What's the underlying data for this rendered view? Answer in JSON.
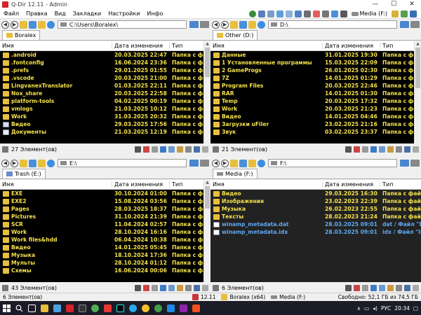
{
  "window": {
    "title": "Q-Dir 12.11 - Admin",
    "controls": [
      "—",
      "☐",
      "✕"
    ]
  },
  "menu": [
    "Файл",
    "Правка",
    "Вид",
    "Закладки",
    "Настройки",
    "Инфо"
  ],
  "toolbar": {
    "drive_label": "Media (F:)"
  },
  "columns": {
    "name": "Имя",
    "date": "Дата изменения",
    "type": "Тип"
  },
  "panes": [
    {
      "tab": "Boralex",
      "path": "C:\\Users\\Boralex\\",
      "status": "27 Элемент(ов)",
      "scroll": {
        "thumb_start": 0.0,
        "thumb_size": 0.33
      },
      "rows": [
        {
          "name": ".android",
          "date": "20.03.2025 22:47",
          "type": "Папка с фай",
          "icon": "folder"
        },
        {
          "name": ".fontconfig",
          "date": "16.06.2024 23:36",
          "type": "Папка с фай",
          "icon": "folder"
        },
        {
          "name": ".prefs",
          "date": "29.01.2025 01:55",
          "type": "Папка с фай",
          "icon": "folder"
        },
        {
          "name": ".vscode",
          "date": "20.03.2025 21:00",
          "type": "Папка с фай",
          "icon": "folder"
        },
        {
          "name": "LingvanexTranslator",
          "date": "01.03.2025 22:11",
          "type": "Папка с фай",
          "icon": "folder"
        },
        {
          "name": "Nox_share",
          "date": "20.03.2025 22:58",
          "type": "Папка с фай",
          "icon": "folder"
        },
        {
          "name": "platform-tools",
          "date": "04.02.2025 00:19",
          "type": "Папка с фай",
          "icon": "folder"
        },
        {
          "name": "vmlogs",
          "date": "21.03.2025 10:12",
          "type": "Папка с фай",
          "icon": "folder"
        },
        {
          "name": "Work",
          "date": "31.03.2025 20:32",
          "type": "Папка с фай",
          "icon": "folder"
        },
        {
          "name": "Видео",
          "date": "29.03.2025 17:56",
          "type": "Папка с фай",
          "icon": "video"
        },
        {
          "name": "Документы",
          "date": "21.03.2025 12:19",
          "type": "Папка с фай",
          "icon": "doc"
        }
      ]
    },
    {
      "tab": "Other (D:)",
      "path": "D:\\",
      "status": "21 Элемент(ов)",
      "scroll": {
        "thumb_start": 0.0,
        "thumb_size": 0.45
      },
      "rows": [
        {
          "name": "Данные",
          "date": "31.01.2025 19:30",
          "type": "Папка с фай",
          "icon": "folder"
        },
        {
          "name": "1 Установленные программы",
          "date": "15.03.2025 22:09",
          "type": "Папка с фай",
          "icon": "folder"
        },
        {
          "name": "2 GameProgs",
          "date": "26.01.2025 02:30",
          "type": "Папка с фай",
          "icon": "folder"
        },
        {
          "name": "7Z",
          "date": "14.01.2025 01:29",
          "type": "Папка с фай",
          "icon": "folder"
        },
        {
          "name": "Program Files",
          "date": "20.03.2025 22:46",
          "type": "Папка с фай",
          "icon": "folder"
        },
        {
          "name": "RAR",
          "date": "14.01.2025 01:30",
          "type": "Папка с фай",
          "icon": "folder"
        },
        {
          "name": "Temp",
          "date": "20.03.2025 17:32",
          "type": "Папка с фай",
          "icon": "folder"
        },
        {
          "name": "Work",
          "date": "20.03.2025 21:23",
          "type": "Папка с фай",
          "icon": "folder"
        },
        {
          "name": "Видео",
          "date": "14.01.2025 04:46",
          "type": "Папка с фай",
          "icon": "folder"
        },
        {
          "name": "Загрузки uFiler",
          "date": "23.02.2025 21:16",
          "type": "Папка с фай",
          "icon": "folder"
        },
        {
          "name": "Звук",
          "date": "03.02.2025 23:37",
          "type": "Папка с фай",
          "icon": "folder"
        }
      ]
    },
    {
      "tab": "Trash (E:)",
      "path": "E:\\",
      "status": "43 Элемент(ов)",
      "scroll": {
        "thumb_start": 0.0,
        "thumb_size": 0.25
      },
      "rows": [
        {
          "name": "EXE",
          "date": "30.10.2024 01:00",
          "type": "Папка с фай",
          "icon": "folder"
        },
        {
          "name": "EXE2",
          "date": "15.08.2024 03:56",
          "type": "Папка с фай",
          "icon": "folder"
        },
        {
          "name": "Pages",
          "date": "28.03.2025 18:37",
          "type": "Папка с фай",
          "icon": "folder"
        },
        {
          "name": "Pictures",
          "date": "31.10.2024 21:39",
          "type": "Папка с фай",
          "icon": "folder"
        },
        {
          "name": "SCR",
          "date": "11.04.2024 02:57",
          "type": "Папка с фай",
          "icon": "folder"
        },
        {
          "name": "Work",
          "date": "28.10.2024 16:16",
          "type": "Папка с фай",
          "icon": "arrow"
        },
        {
          "name": "Work files&hdd",
          "date": "06.04.2024 10:38",
          "type": "Папка с фай",
          "icon": "folder"
        },
        {
          "name": "Видео",
          "date": "14.01.2025 05:45",
          "type": "Папка с фай",
          "icon": "folder"
        },
        {
          "name": "Музыка",
          "date": "18.10.2024 17:36",
          "type": "Папка с фай",
          "icon": "folder"
        },
        {
          "name": "Мульты",
          "date": "28.10.2024 01:12",
          "type": "Папка с фай",
          "icon": "folder"
        },
        {
          "name": "Схемы",
          "date": "16.06.2024 00:06",
          "type": "Папка с фай",
          "icon": "folder"
        }
      ]
    },
    {
      "tab": "Media (F:)",
      "path": "F:\\",
      "status": "6 Элемент(ов)",
      "scroll": null,
      "rows": [
        {
          "name": "Видео",
          "date": "29.03.2025 16:30",
          "type": "Папка с фай",
          "icon": "folder"
        },
        {
          "name": "Изображения",
          "date": "23.02.2023 22:39",
          "type": "Папка с фай",
          "icon": "folder"
        },
        {
          "name": "Музыка",
          "date": "26.02.2023 22:55",
          "type": "Папка с фай",
          "icon": "folder"
        },
        {
          "name": "Тексты",
          "date": "28.02.2023 21:24",
          "type": "Папка с фай",
          "icon": "folder"
        },
        {
          "name": "winamp_metadata.dat",
          "date": "28.03.2025 09:01",
          "type": "dat / Файл \"DA",
          "icon": "file",
          "blue": true
        },
        {
          "name": "winamp_metadata.idx",
          "date": "28.03.2025 09:01",
          "type": "idx / Файл \"IDX",
          "icon": "file",
          "blue": true
        }
      ]
    }
  ],
  "global_status": {
    "items": "6 Элемент(ов)",
    "version": "12.11",
    "user": "Boralex (x64)",
    "drive": "Media (F:)",
    "free": "Свободно: 52,1 ГБ из 74,5 ГБ"
  },
  "taskbar": {
    "lang": "РУС",
    "time": "20:34"
  }
}
